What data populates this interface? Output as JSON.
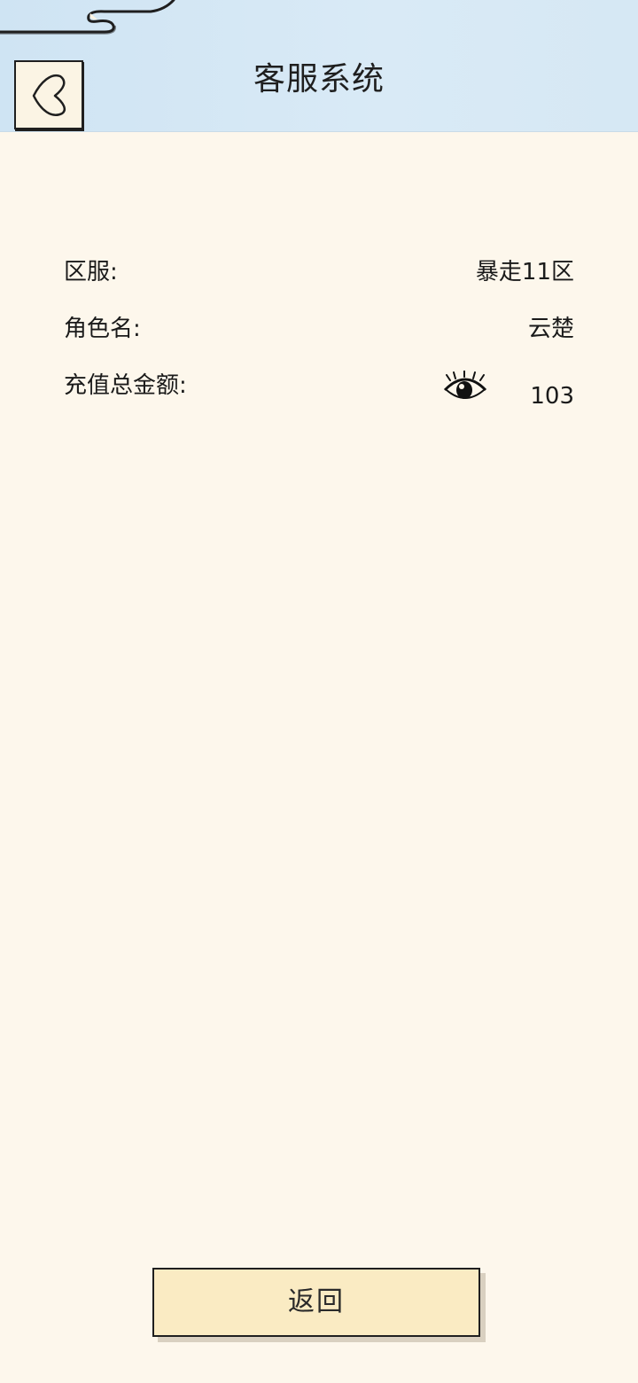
{
  "header": {
    "title": "客服系统",
    "back_icon": "chevron-left-icon"
  },
  "info": {
    "server": {
      "label": "区服:",
      "value": "暴走11区"
    },
    "role": {
      "label": "角色名:",
      "value": "云楚"
    },
    "recharge": {
      "label": "充值总金额:",
      "value": "103",
      "toggle_icon": "eye-icon"
    }
  },
  "footer": {
    "return_label": "返回"
  },
  "colors": {
    "background": "#fdf7ec",
    "header_bg": "#d6e8f4",
    "button_bg": "#faebc3",
    "ink": "#1f1f1f"
  }
}
